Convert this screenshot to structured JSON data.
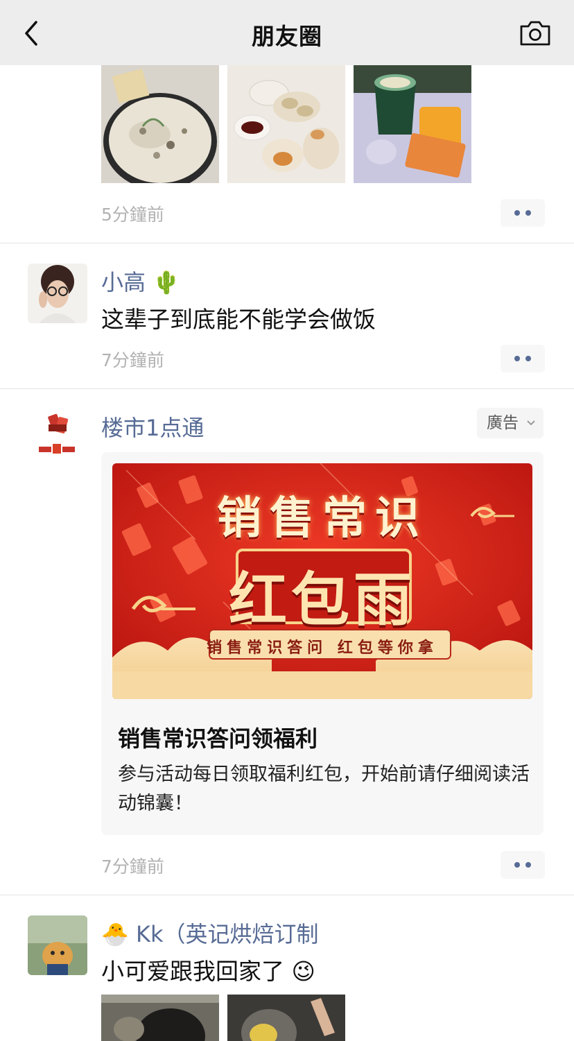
{
  "header": {
    "title": "朋友圈",
    "back_icon": "chevron-left-icon",
    "camera_icon": "camera-icon"
  },
  "feed": {
    "post1": {
      "time": "5分鐘前",
      "photos": [
        "food-photo-soup",
        "food-photo-dumplings",
        "food-photo-drink"
      ]
    },
    "post2": {
      "name": "小高",
      "name_emoji": "🌵",
      "text": "这辈子到底能不能学会做饭",
      "time": "7分鐘前"
    },
    "ad": {
      "name": "楼市1点通",
      "ad_label": "廣告",
      "banner_title": "销售常识",
      "banner_main": "红包雨",
      "banner_sub": "销售常识答问  红包等你拿",
      "headline": "销售常识答问领福利",
      "description": "参与活动每日领取福利红包，开始前请仔细阅读活动锦囊！",
      "time": "7分鐘前",
      "brand_colors": {
        "banner_red": "#d8261c",
        "banner_gold": "#f7d38a"
      }
    },
    "post4": {
      "name_emoji": "🐣",
      "name": "Kk（英记烘焙订制",
      "text": "小可爱跟我回家了",
      "text_emoji": "😉"
    }
  },
  "colors": {
    "link_blue": "#576b95",
    "time_gray": "#b2b2b2",
    "header_bg": "#ededed"
  }
}
